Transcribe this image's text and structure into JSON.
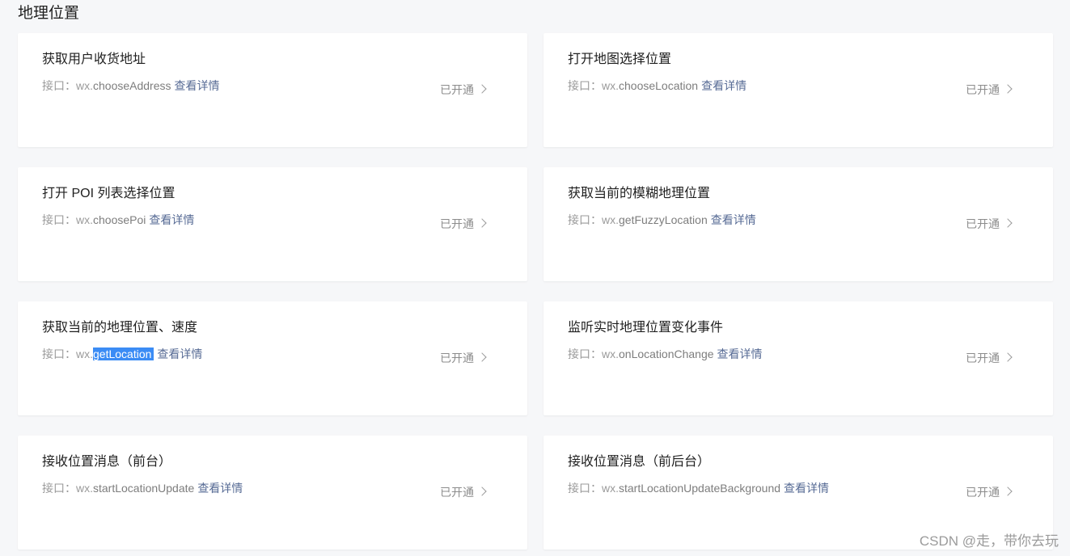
{
  "page": {
    "title": "地理位置"
  },
  "cards": [
    {
      "title": "获取用户收货地址",
      "prefix": "接口：wx.",
      "api": "chooseAddress",
      "link": "查看详情",
      "status": "已开通"
    },
    {
      "title": "打开地图选择位置",
      "prefix": "接口：wx.",
      "api": "chooseLocation",
      "link": "查看详情",
      "status": "已开通"
    },
    {
      "title": "打开 POI 列表选择位置",
      "prefix": "接口：wx.",
      "api": "choosePoi",
      "link": "查看详情",
      "status": "已开通"
    },
    {
      "title": "获取当前的模糊地理位置",
      "prefix": "接口：wx.",
      "api": "getFuzzyLocation",
      "link": "查看详情",
      "status": "已开通"
    },
    {
      "title": "获取当前的地理位置、速度",
      "prefix": "接口：wx.",
      "api": "getLocation",
      "link": "查看详情",
      "status": "已开通"
    },
    {
      "title": "监听实时地理位置变化事件",
      "prefix": "接口：wx.",
      "api": "onLocationChange",
      "link": "查看详情",
      "status": "已开通"
    },
    {
      "title": "接收位置消息（前台）",
      "prefix": "接口：wx.",
      "api": "startLocationUpdate",
      "link": "查看详情",
      "status": "已开通"
    },
    {
      "title": "接收位置消息（前后台）",
      "prefix": "接口：wx.",
      "api": "startLocationUpdateBackground",
      "link": "查看详情",
      "status": "已开通"
    }
  ],
  "watermark": "CSDN @走，带你去玩",
  "colors": {
    "background": "#f6f7f9",
    "link": "#576b95",
    "selection": "#3b8cf5"
  }
}
